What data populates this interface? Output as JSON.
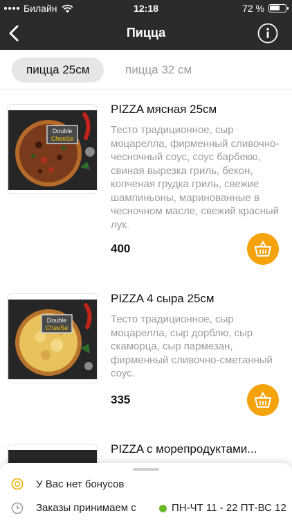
{
  "status_bar": {
    "carrier": "Билайн",
    "time": "12:18",
    "battery_text": "72 %",
    "battery_level": 0.72
  },
  "header": {
    "title": "Пицца",
    "back_icon": "chevron-left-icon",
    "info_icon": "info-icon"
  },
  "tabs": [
    {
      "label": "пицца 25см",
      "active": true
    },
    {
      "label": "пицца 32 см",
      "active": false
    }
  ],
  "products": [
    {
      "title": "PIZZA мясная 25см",
      "description": "Тесто традиционное, сыр моцарелла, фирменный сливочно-чесночный соус, соус барбекю, свиная вырезка гриль, бекон, копченая грудка гриль, свежие шампиньоны, маринованные в чесночном масле, свежий красный лук.",
      "price": "400",
      "badge_line1": "Double",
      "badge_line2": "CheeSe"
    },
    {
      "title": "PIZZA 4 сыра 25см",
      "description": "Тесто традиционное, сыр моцарелла, сыр дорблю, сыр скаморца, сыр пармезан, фирменный сливочно-сметанный соус.",
      "price": "335",
      "badge_line1": "Double",
      "badge_line2": "CheeSe"
    },
    {
      "title": "PIZZA с морепродуктами..."
    }
  ],
  "bottom_panel": {
    "bonus_text": "У Вас нет бонусов",
    "orders_text": "Заказы принимаем с",
    "schedule_text": "ПН-ЧТ 11 - 22 ПТ-ВС 12",
    "open_status_color": "#69b72b"
  },
  "colors": {
    "bar": "#2b2b2b",
    "accent": "#f5a30d",
    "muted": "#9c9c9c"
  }
}
